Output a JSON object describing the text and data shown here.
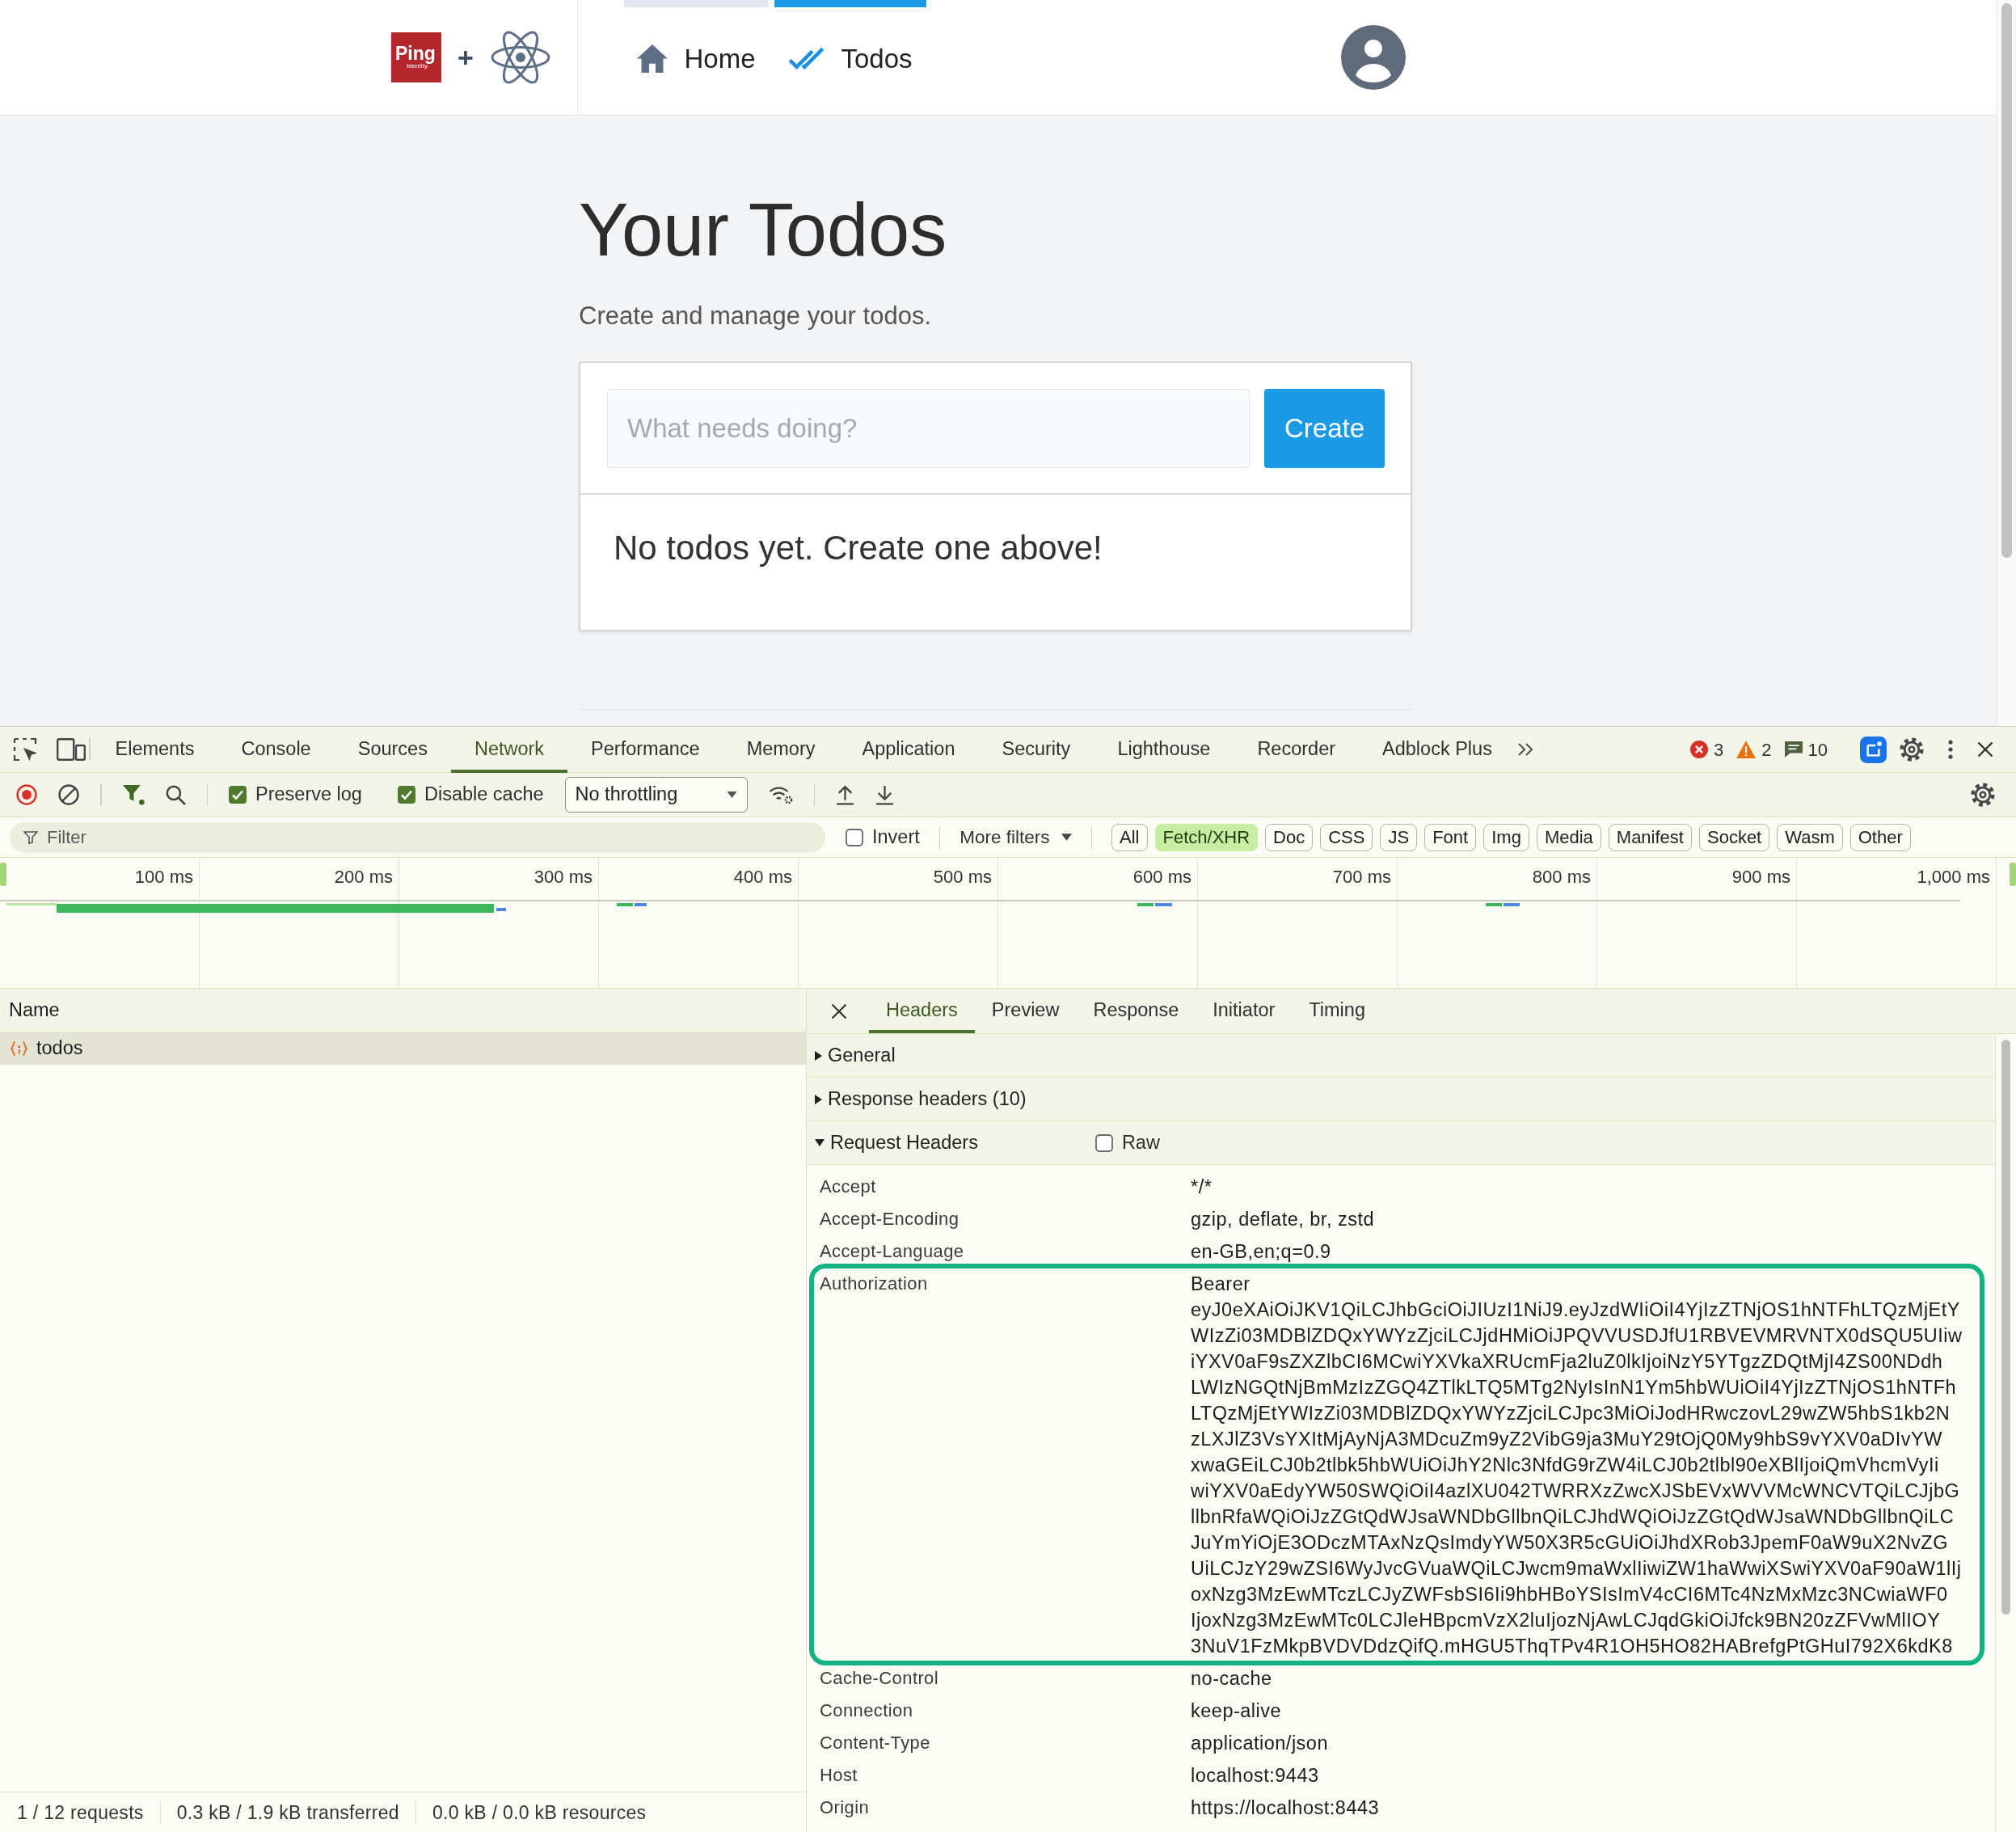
{
  "app": {
    "brand": {
      "logo_text": "Ping",
      "logo_subtext": "Identity.",
      "separator": "+"
    },
    "nav": [
      {
        "kind": "home",
        "label": "Home",
        "selected": false,
        "hovered": true
      },
      {
        "kind": "todos",
        "label": "Todos",
        "selected": true,
        "hovered": false
      }
    ],
    "heading": "Your Todos",
    "subheading": "Create and manage your todos.",
    "new_todo": {
      "placeholder": "What needs doing?",
      "button": "Create"
    },
    "empty_message": "No todos yet. Create one above!"
  },
  "devtools": {
    "tabs": [
      {
        "label": "Elements",
        "selected": false
      },
      {
        "label": "Console",
        "selected": false
      },
      {
        "label": "Sources",
        "selected": false
      },
      {
        "label": "Network",
        "selected": true
      },
      {
        "label": "Performance",
        "selected": false
      },
      {
        "label": "Memory",
        "selected": false
      },
      {
        "label": "Application",
        "selected": false
      },
      {
        "label": "Security",
        "selected": false
      },
      {
        "label": "Lighthouse",
        "selected": false
      },
      {
        "label": "Recorder",
        "selected": false
      },
      {
        "label": "Adblock Plus",
        "selected": false
      }
    ],
    "counts": [
      {
        "kind": "error",
        "count": "3"
      },
      {
        "kind": "warning",
        "count": "2"
      },
      {
        "kind": "message",
        "count": "10"
      }
    ],
    "toolbar": {
      "recording": true,
      "options": [
        {
          "label": "Preserve log",
          "checked": true
        },
        {
          "label": "Disable cache",
          "checked": true
        }
      ],
      "throttling": "No throttling"
    },
    "filter": {
      "placeholder": "Filter",
      "invert": {
        "label": "Invert",
        "checked": false
      },
      "more_filters": "More filters",
      "types": [
        {
          "label": "All",
          "selected": false
        },
        {
          "label": "Fetch/XHR",
          "selected": true
        },
        {
          "label": "Doc",
          "selected": false
        },
        {
          "label": "CSS",
          "selected": false
        },
        {
          "label": "JS",
          "selected": false
        },
        {
          "label": "Font",
          "selected": false
        },
        {
          "label": "Img",
          "selected": false
        },
        {
          "label": "Media",
          "selected": false
        },
        {
          "label": "Manifest",
          "selected": false
        },
        {
          "label": "Socket",
          "selected": false
        },
        {
          "label": "Wasm",
          "selected": false
        },
        {
          "label": "Other",
          "selected": false
        }
      ]
    },
    "overview": {
      "ticks": [
        "100 ms",
        "200 ms",
        "300 ms",
        "400 ms",
        "500 ms",
        "600 ms",
        "700 ms",
        "800 ms",
        "900 ms",
        "1,000 ms"
      ]
    },
    "requests": {
      "column": "Name",
      "rows": [
        {
          "name": "todos",
          "selected": true
        }
      ]
    },
    "details": {
      "tabs": [
        {
          "label": "Headers",
          "selected": true
        },
        {
          "label": "Preview",
          "selected": false
        },
        {
          "label": "Response",
          "selected": false
        },
        {
          "label": "Initiator",
          "selected": false
        },
        {
          "label": "Timing",
          "selected": false
        }
      ],
      "sections": [
        {
          "title": "General",
          "expanded": false
        },
        {
          "title": "Response headers (10)",
          "expanded": false
        },
        {
          "title": "Request Headers",
          "expanded": true,
          "raw": {
            "label": "Raw",
            "checked": false
          },
          "headers": [
            {
              "name": "Accept",
              "value": [
                "*/*"
              ],
              "highlighted": false
            },
            {
              "name": "Accept-Encoding",
              "value": [
                "gzip, deflate, br, zstd"
              ],
              "highlighted": false
            },
            {
              "name": "Accept-Language",
              "value": [
                "en-GB,en;q=0.9"
              ],
              "highlighted": false
            },
            {
              "name": "Authorization",
              "value": [
                "Bearer",
                "eyJ0eXAiOiJKV1QiLCJhbGciOiJIUzI1NiJ9.eyJzdWIiOiI4YjIzZTNjOS1hNTFhLTQzMjEtY",
                "WIzZi03MDBlZDQxYWYzZjciLCJjdHMiOiJPQVVUSDJfU1RBVEVMRVNTX0dSQU5UIiw",
                "iYXV0aF9sZXZlbCI6MCwiYXVkaXRUcmFja2luZ0lkIjoiNzY5YTgzZDQtMjI4ZS00NDdh",
                "LWIzNGQtNjBmMzIzZGQ4ZTlkLTQ5MTg2NyIsInN1Ym5hbWUiOiI4YjIzZTNjOS1hNTFh",
                "LTQzMjEtYWIzZi03MDBlZDQxYWYzZjciLCJpc3MiOiJodHRwczovL29wZW5hbS1kb2N",
                "zLXJlZ3VsYXItMjAyNjA3MDcuZm9yZ2VibG9ja3MuY29tOjQ0My9hbS9vYXV0aDIvYW",
                "xwaGEiLCJ0b2tlbk5hbWUiOiJhY2Nlc3NfdG9rZW4iLCJ0b2tlbl90eXBlIjoiQmVhcmVyIi",
                "wiYXV0aEdyYW50SWQiOiI4azlXU042TWRRXzZwcXJSbEVxWVVMcWNCVTQiLCJjbG",
                "llbnRfaWQiOiJzZGtQdWJsaWNDbGllbnQiLCJhdWQiOiJzZGtQdWJsaWNDbGllbnQiLC",
                "JuYmYiOjE3ODczMTAxNzQsImdyYW50X3R5cGUiOiJhdXRob3JpemF0aW9uX2NvZG",
                "UiLCJzY29wZSI6WyJvcGVuaWQiLCJwcm9maWxlIiwiZW1haWwiXSwiYXV0aF90aW1lIj",
                "oxNzg3MzEwMTczLCJyZWFsbSI6Ii9hbHBoYSIsImV4cCI6MTc4NzMxMzc3NCwiaWF0",
                "IjoxNzg3MzEwMTc0LCJleHBpcmVzX2luIjozNjAwLCJqdGkiOiJfck9BN20zZFVwMlIOY",
                "3NuV1FzMkpBVDVDdzQifQ.mHGU5ThqTPv4R1OH5HO82HABrefgPtGHuI792X6kdK8"
              ],
              "highlighted": true
            },
            {
              "name": "Cache-Control",
              "value": [
                "no-cache"
              ],
              "highlighted": false
            },
            {
              "name": "Connection",
              "value": [
                "keep-alive"
              ],
              "highlighted": false
            },
            {
              "name": "Content-Type",
              "value": [
                "application/json"
              ],
              "highlighted": false
            },
            {
              "name": "Host",
              "value": [
                "localhost:9443"
              ],
              "highlighted": false
            },
            {
              "name": "Origin",
              "value": [
                "https://localhost:8443"
              ],
              "highlighted": false
            }
          ]
        }
      ]
    },
    "status_bar": [
      "1 / 12 requests",
      "0.3 kB / 1.9 kB transferred",
      "0.0 kB / 0.0 kB resources"
    ]
  }
}
